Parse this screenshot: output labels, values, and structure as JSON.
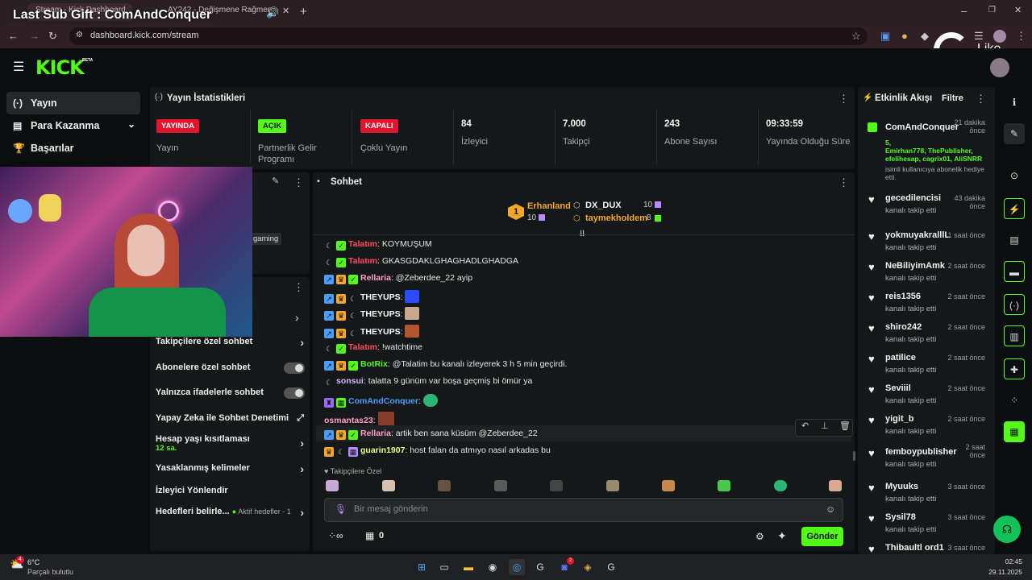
{
  "overlay": {
    "last_sub_gift": "Last Sub Gift : ComAndConquer",
    "like_label": "Like"
  },
  "browser": {
    "tabs": [
      {
        "label": "Stream - Kick Dashboard"
      },
      {
        "label": "AY242 - Değişmene Rağmen"
      }
    ],
    "new_tab": "+",
    "url": "dashboard.kick.com/stream"
  },
  "kick": {
    "logo": "KICK",
    "beta": "BETA"
  },
  "sidebar": {
    "items": [
      {
        "label": "Yayın"
      },
      {
        "label": "Para Kazanma"
      },
      {
        "label": "Başarılar"
      }
    ]
  },
  "stats": {
    "title": "Yayın İstatistikleri",
    "cells": [
      {
        "badge": "YAYINDA",
        "label": "Yayın",
        "color": "#e3142b"
      },
      {
        "badge": "AÇIK",
        "label": "Partnerlik Gelir Programı",
        "color": "#53fc18"
      },
      {
        "badge": "KAPALI",
        "label": "Çoklu Yayın",
        "color": "#e3142b"
      },
      {
        "value": "84",
        "label": "İzleyici"
      },
      {
        "value": "7.000",
        "label": "Takipçi"
      },
      {
        "value": "243",
        "label": "Abone Sayısı"
      },
      {
        "value": "09:33:59",
        "label": "Yayında Olduğu Süre"
      }
    ]
  },
  "stream_info": {
    "category_tag": "gaming"
  },
  "chat_settings": {
    "rows": [
      {
        "label": "Takipçilere özel sohbet"
      },
      {
        "label": "Abonelere özel sohbet"
      },
      {
        "label": "Yalnızca ifadelerle sohbet"
      },
      {
        "label": "Yapay Zeka ile Sohbet Denetimi"
      },
      {
        "label": "Hesap yaşı kısıtlaması",
        "sub": "12 sa."
      },
      {
        "label": "Yasaklanmış kelimeler"
      },
      {
        "label": "İzleyici Yönlendir"
      },
      {
        "label": "Hedefleri belirle...",
        "extra": "Aktif hedefler - 1"
      }
    ]
  },
  "chat": {
    "title": "Sohbet",
    "leaderboard": [
      {
        "rank": "1",
        "name": "Erhanland",
        "count": "10"
      },
      {
        "name": "DX_DUX",
        "count": "10"
      },
      {
        "name": "taymekholdem",
        "count": "8"
      }
    ],
    "messages": [
      {
        "user": "Talatım",
        "text": "KOYMUŞUM",
        "color": "#ff4d5e"
      },
      {
        "user": "Talatım",
        "text": "GKASGDAKLGHAGHADLGHADGA",
        "color": "#ff4d5e"
      },
      {
        "user": "Rellaria",
        "text": "@Zeberdee_22 ayip",
        "color": "#ff9ec9"
      },
      {
        "user": "THEYUPS",
        "text": "",
        "color": "#ffffff"
      },
      {
        "user": "THEYUPS",
        "text": "",
        "color": "#ffffff"
      },
      {
        "user": "THEYUPS",
        "text": "",
        "color": "#ffffff"
      },
      {
        "user": "Talatım",
        "text": "!watchtime",
        "color": "#ff4d5e"
      },
      {
        "user": "BotRix",
        "text": "@Talatim bu kanalı izleyerek 3 h 5 min geçirdi.",
        "color": "#53fc18"
      },
      {
        "user": "sonsui",
        "text": "talatta 9 günüm var boşa geçmiş bi ömür ya",
        "color": "#d9b3ff"
      },
      {
        "user": "ComAndConquer",
        "text": "",
        "color": "#4a9cff"
      },
      {
        "user": "osmantas23",
        "text": "",
        "color": "#ff9ec9"
      },
      {
        "user": "Rellaria",
        "text": "artik ben sana küsüm @Zeberdee_22",
        "color": "#ff9ec9"
      },
      {
        "user": "guarin1907",
        "text": "host falan da atmıyo nasıl arkadas bu",
        "color": "#e5ff7a"
      }
    ],
    "emote_bar_label": "Takipçilere Özel",
    "input_placeholder": "Bir mesaj gönderin",
    "points": "0",
    "send_label": "Gönder"
  },
  "activity": {
    "title": "Etkinlik Akışı",
    "filter_label": "Filtre",
    "gift": {
      "name": "ComAndConquer",
      "time": "21 dakika önce",
      "count": "5,",
      "gifted": "Emirhan778, ThePublisher, efelihesap, cagrix01, AliSNRR",
      "desc": "isimli kullanıcıya abonelik hediye etti."
    },
    "items": [
      {
        "name": "gecedilencisi",
        "time": "43 dakika önce",
        "desc": "kanalı takip etti"
      },
      {
        "name": "yokmuyakralllL",
        "time": "1 saat önce",
        "desc": "kanalı takip etti"
      },
      {
        "name": "NeBiliyimAmk",
        "time": "2 saat önce",
        "desc": "kanalı takip etti"
      },
      {
        "name": "reis1356",
        "time": "2 saat önce",
        "desc": "kanalı takip etti"
      },
      {
        "name": "shiro242",
        "time": "2 saat önce",
        "desc": "kanalı takip etti"
      },
      {
        "name": "patilice",
        "time": "2 saat önce",
        "desc": "kanalı takip etti"
      },
      {
        "name": "Seviiil",
        "time": "2 saat önce",
        "desc": "kanalı takip etti"
      },
      {
        "name": "yigit_b",
        "time": "2 saat önce",
        "desc": "kanalı takip etti"
      },
      {
        "name": "femboypublisher",
        "time": "2 saat önce",
        "desc": "kanalı takip etti"
      },
      {
        "name": "Myuuks",
        "time": "3 saat önce",
        "desc": "kanalı takip etti"
      },
      {
        "name": "Sysil78",
        "time": "3 saat önce",
        "desc": "kanalı takip etti"
      },
      {
        "name": "Thibaultl ord1",
        "time": "3 saat önce",
        "desc": ""
      }
    ]
  },
  "taskbar": {
    "weather_temp": "6°C",
    "weather_desc": "Parçalı bulutlu",
    "time": "02:45",
    "date": "29.11.2025",
    "weather_badge": "4",
    "discord_badge": "2"
  },
  "colors": {
    "kick_green": "#53fc18",
    "live_red": "#e3142b",
    "panel": "#151819"
  }
}
